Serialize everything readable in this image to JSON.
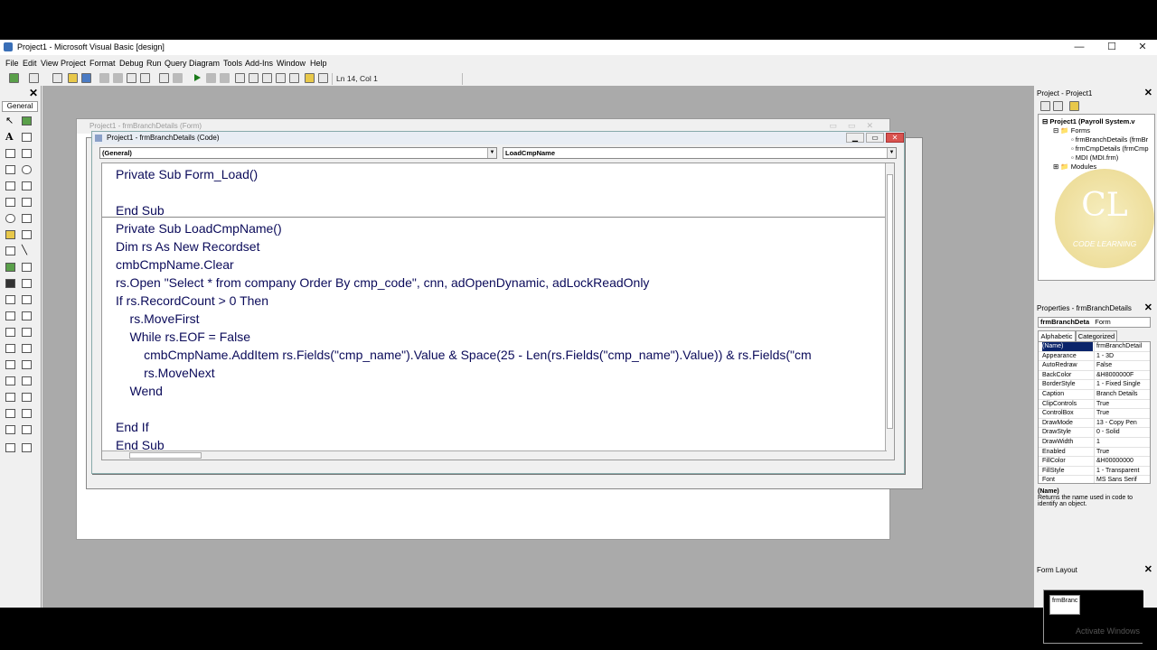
{
  "window": {
    "title": "Project1 - Microsoft Visual Basic [design]",
    "minimize": "—",
    "maximize": "☐",
    "close": "✕"
  },
  "menu": [
    "File",
    "Edit",
    "View",
    "Project",
    "Format",
    "Debug",
    "Run",
    "Query",
    "Diagram",
    "Tools",
    "Add-Ins",
    "Window",
    "Help"
  ],
  "toolbar": {
    "position": "Ln 14, Col 1"
  },
  "toolbox": {
    "tab_label": "General",
    "close": "✕"
  },
  "form_window": {
    "title": "Project1 - frmBranchDetails (Form)"
  },
  "code_window": {
    "title": "Project1 - frmBranchDetails (Code)",
    "object_combo": "(General)",
    "procedure_combo": "LoadCmpName",
    "lines": [
      "Private Sub Form_Load()",
      "",
      "End Sub",
      "Private Sub LoadCmpName()",
      "Dim rs As New Recordset",
      "cmbCmpName.Clear",
      "rs.Open \"Select * from company Order By cmp_code\", cnn, adOpenDynamic, adLockReadOnly",
      "If rs.RecordCount > 0 Then",
      "    rs.MoveFirst",
      "    While rs.EOF = False",
      "        cmbCmpName.AddItem rs.Fields(\"cmp_name\").Value & Space(25 - Len(rs.Fields(\"cmp_name\").Value)) & rs.Fields(\"cm",
      "        rs.MoveNext",
      "    Wend",
      "",
      "End If",
      "End Sub"
    ]
  },
  "project_panel": {
    "title": "Project - Project1",
    "close": "✕",
    "root": "Project1 (Payroll System.v",
    "forms_folder": "Forms",
    "forms": [
      "frmBranchDetails (frmBr",
      "frmCmpDetails (frmCmp",
      "MDI (MDI.frm)"
    ],
    "modules_folder": "Modules",
    "logo_text": "CODE LEARNING"
  },
  "properties_panel": {
    "title": "Properties - frmBranchDetails",
    "close": "✕",
    "object_name": "frmBranchDeta",
    "object_type": "Form",
    "tabs": [
      "Alphabetic",
      "Categorized"
    ],
    "rows": [
      {
        "name": "(Name)",
        "value": "frmBranchDetail"
      },
      {
        "name": "Appearance",
        "value": "1 - 3D"
      },
      {
        "name": "AutoRedraw",
        "value": "False"
      },
      {
        "name": "BackColor",
        "value": "&H8000000F"
      },
      {
        "name": "BorderStyle",
        "value": "1 - Fixed Single"
      },
      {
        "name": "Caption",
        "value": "Branch Details"
      },
      {
        "name": "ClipControls",
        "value": "True"
      },
      {
        "name": "ControlBox",
        "value": "True"
      },
      {
        "name": "DrawMode",
        "value": "13 - Copy Pen"
      },
      {
        "name": "DrawStyle",
        "value": "0 - Solid"
      },
      {
        "name": "DrawWidth",
        "value": "1"
      },
      {
        "name": "Enabled",
        "value": "True"
      },
      {
        "name": "FillColor",
        "value": "&H00000000"
      },
      {
        "name": "FillStyle",
        "value": "1 - Transparent"
      },
      {
        "name": "Font",
        "value": "MS Sans Serif"
      }
    ],
    "desc_title": "(Name)",
    "desc_text": "Returns the name used in code to identify an object."
  },
  "layout_panel": {
    "title": "Form Layout",
    "close": "✕",
    "form_label": "frmBranc",
    "watermark": "Activate Windows"
  }
}
